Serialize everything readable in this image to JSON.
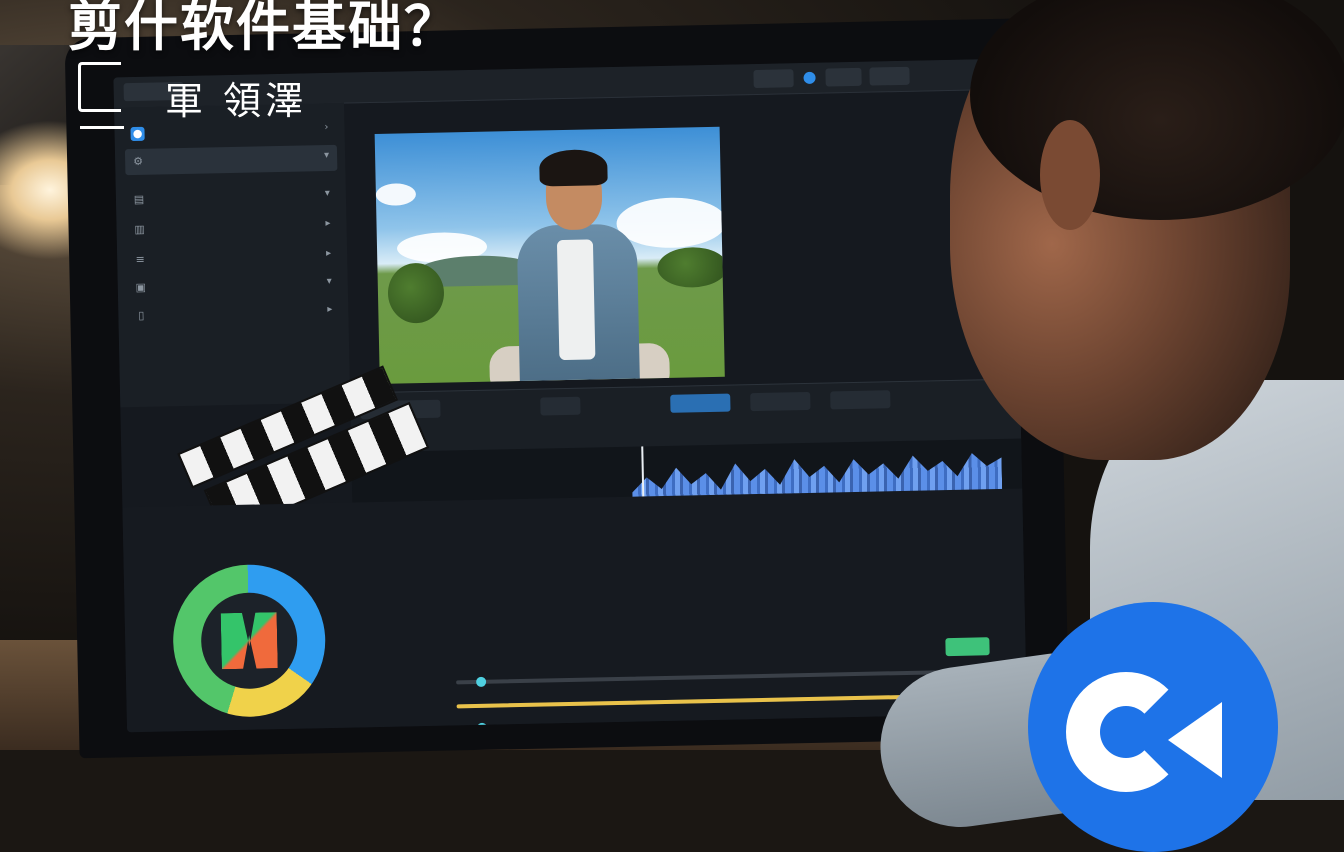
{
  "overlay": {
    "title": "剪什软件基础？",
    "subtitle": "軍 領澤"
  },
  "colors": {
    "accent": "#2f8de8",
    "clip_blue": "#4f86e6",
    "clip_green": "#5fd38f",
    "badge": "#1e73e8"
  },
  "topbar": {
    "buttons": [
      "",
      "",
      "",
      ""
    ]
  },
  "sidebar": {
    "items": [
      {
        "icon": "camera-icon",
        "label": "",
        "active": false
      },
      {
        "icon": "gear-icon",
        "label": "",
        "active": true
      },
      {
        "icon": "file-icon",
        "label": "",
        "active": false
      },
      {
        "icon": "chart-icon",
        "label": "",
        "active": false
      },
      {
        "icon": "list-icon",
        "label": "",
        "active": false
      },
      {
        "icon": "image-icon",
        "label": "",
        "active": false
      },
      {
        "icon": "page-icon",
        "label": "",
        "active": false
      }
    ]
  },
  "timeline": {
    "tabs": [
      "",
      "",
      "",
      "",
      ""
    ],
    "tracks": [
      "",
      "",
      "",
      "",
      ""
    ]
  },
  "bottom": {
    "labels": [
      "",
      "",
      ""
    ],
    "sliders": [
      0.05,
      0.9,
      0.05
    ]
  }
}
